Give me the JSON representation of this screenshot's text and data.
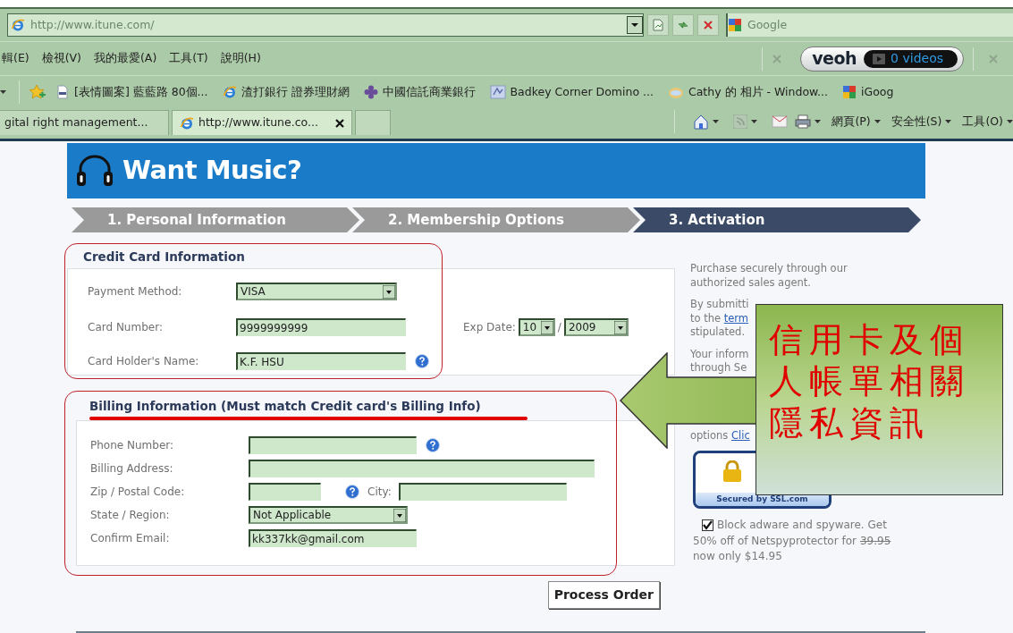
{
  "browser": {
    "address_bar": {
      "url": "http://www.itune.com/"
    },
    "search_field": {
      "placeholder": "Google"
    },
    "menu": [
      "輯(E)",
      "檢視(V)",
      "我的最愛(A)",
      "工具(T)",
      "說明(H)"
    ],
    "veoh_toolbar": {
      "logo": "veoh",
      "videos": "0 videos"
    },
    "favorites": [
      {
        "label": "[表情圖案] 藍藍路 80個...",
        "kind": "page"
      },
      {
        "label": "渣打銀行 證券理財網",
        "kind": "ie"
      },
      {
        "label": "中國信託商業銀行",
        "kind": "bank"
      },
      {
        "label": "Badkey Corner  Domino ...",
        "kind": "site"
      },
      {
        "label": "Cathy 的 相片 - Window...",
        "kind": "photo"
      },
      {
        "label": "iGoog",
        "kind": "google"
      }
    ],
    "tabs": [
      {
        "label": "gital right management...",
        "selected": false
      },
      {
        "label": "http://www.itune.co...",
        "selected": true
      }
    ],
    "commands": [
      "網頁(P)",
      "安全性(S)",
      "工具(O)"
    ]
  },
  "page": {
    "logo": "Want Music?",
    "steps": [
      {
        "label": "1. Personal Information",
        "selected": false
      },
      {
        "label": "2. Membership Options",
        "selected": false
      },
      {
        "label": "3. Activation",
        "selected": true
      }
    ],
    "credit_card": {
      "title": "Credit Card Information",
      "fields": [
        {
          "label": "Payment Method:",
          "kind": "select",
          "value": "VISA",
          "help": false
        },
        {
          "label": "Card Number:",
          "kind": "input",
          "value": "9999999999",
          "help": false
        },
        {
          "label": "Card Holder's Name:",
          "kind": "input",
          "value": "K.F. HSU",
          "help": true
        }
      ],
      "exp_date": {
        "label": "Exp Date:",
        "month": "10",
        "separator": "/",
        "year": "2009"
      }
    },
    "billing": {
      "title": "Billing Information (Must match Credit card's Billing Info)",
      "fields": [
        {
          "label": "Phone Number:",
          "kind": "input",
          "help": true
        },
        {
          "label": "Billing Address:",
          "kind": "input",
          "help": false
        },
        {
          "label": "Zip / Postal Code:",
          "kind": "input",
          "help": true,
          "extra_label": "City:"
        },
        {
          "label": "State / Region:",
          "kind": "select",
          "value": "Not Applicable",
          "help": false
        },
        {
          "label": "Confirm Email:",
          "kind": "input",
          "value": "kk337kk@gmail.com",
          "help": false
        }
      ]
    },
    "sidebar": {
      "paragraphs": [
        {
          "lines": [
            {
              "text": "Purchase securely through our"
            },
            {
              "text": "authorized sales agent."
            }
          ]
        },
        {
          "lines": [
            {
              "text": "By submitti"
            },
            {
              "text": "to the",
              "link": "term"
            },
            {
              "text": "stipulated."
            }
          ]
        },
        {
          "lines": [
            {
              "text": "Your inform"
            },
            {
              "text": "through Se"
            }
          ]
        },
        {
          "lines": [
            {
              "text": "options",
              "link": "Clic"
            }
          ]
        }
      ]
    },
    "ssl_badge": {
      "caption": "Secured by SSL.com"
    },
    "offer": {
      "checked": true,
      "lines": [
        {
          "text": "Block adware and spyware. Get"
        },
        {
          "text": "50% off of Netspyprotector for",
          "struck": "39.95"
        },
        {
          "text": "now only $14.95"
        }
      ]
    },
    "button": "Process Order",
    "annotation": {
      "text": "信用卡及個人帳單相關隱私資訊"
    }
  }
}
